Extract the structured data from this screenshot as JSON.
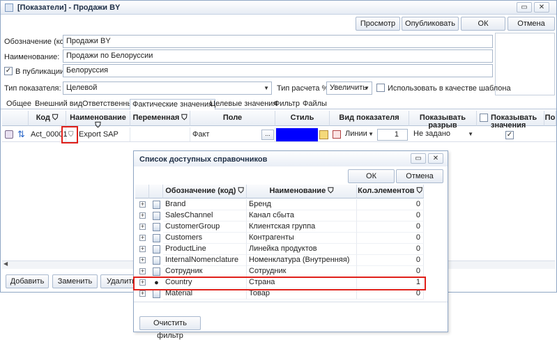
{
  "window": {
    "title": "[Показатели] - Продажи BY",
    "restore_btn": "▭",
    "close_btn": "✕"
  },
  "toolbar": {
    "preview_label": "Просмотр",
    "publish_label": "Опубликовать",
    "ok_label": "ОК",
    "cancel_label": "Отмена"
  },
  "form": {
    "code_label": "Обозначение (код):",
    "code_value": "Продажи BY",
    "name_label": "Наименование:",
    "name_value": "Продажи по Белоруссии",
    "publication_label": "В публикации:",
    "publication_checked": "✓",
    "publication_value": "Белоруссия",
    "type_label": "Тип показателя:",
    "type_value": "Целевой",
    "calc_label": "Тип расчета % :",
    "calc_value": "Увеличить",
    "template_label": "Использовать в качестве шаблона"
  },
  "tabs": [
    "Общее",
    "Внешний вид",
    "Ответственные",
    "Фактические значения",
    "Целевые значения",
    "Фильтр",
    "Файлы"
  ],
  "grid": {
    "headers": {
      "code": "Код",
      "name": "Наименование",
      "variable": "Переменная",
      "field": "Поле",
      "style": "Стиль",
      "view": "Вид показателя",
      "gap": "Показывать разрыв",
      "show_values": "Показывать значения",
      "more": "По"
    },
    "row": {
      "code": "Act_00001",
      "name": "Export SAP",
      "field": "Факт",
      "field_btn": "...",
      "view": "Линии",
      "view_num": "1",
      "gap": "Не задано",
      "show_values": "✓"
    },
    "style_color": "#0000ff"
  },
  "bottom": {
    "add_label": "Добавить",
    "replace_label": "Заменить",
    "delete_label": "Удалить"
  },
  "popup": {
    "title": "Список доступных справочников",
    "ok_label": "ОК",
    "cancel_label": "Отмена",
    "headers": {
      "code": "Обозначение (код)",
      "name": "Наименование",
      "count": "Кол.элементов"
    },
    "rows": [
      {
        "code": "Brand",
        "name": "Бренд",
        "count": "0"
      },
      {
        "code": "SalesChannel",
        "name": "Канал сбыта",
        "count": "0"
      },
      {
        "code": "CustomerGroup",
        "name": "Клиентская группа",
        "count": "0"
      },
      {
        "code": "Customers",
        "name": "Контрагенты",
        "count": "0"
      },
      {
        "code": "ProductLine",
        "name": "Линейка продуктов",
        "count": "0"
      },
      {
        "code": "InternalNomenclature",
        "name": "Номенклатура (Внутренняя)",
        "count": "0"
      },
      {
        "code": "Сотрудник",
        "name": "Сотрудник",
        "count": "0"
      },
      {
        "code": "Country",
        "name": "Страна",
        "count": "1"
      },
      {
        "code": "Material",
        "name": "Товар",
        "count": "0"
      }
    ],
    "clear_filter_label": "Очистить фильтр"
  },
  "colors": {
    "highlight_red": "#e0201a",
    "accent_blue": "#0000ff"
  }
}
